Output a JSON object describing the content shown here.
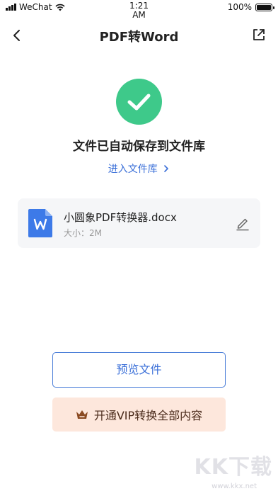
{
  "status_bar": {
    "carrier": "WeChat",
    "time": "1:21\nAM",
    "time_line1": "1:21",
    "time_line2": "AM",
    "battery": "100%",
    "battery_level": 1.0
  },
  "nav": {
    "title": "PDF转Word"
  },
  "success": {
    "message": "文件已自动保存到文件库",
    "library_link": "进入文件库",
    "color": "#3ec98a"
  },
  "file": {
    "name": "小圆象PDF转换器.docx",
    "size": "大小：2M",
    "icon": "word-doc-icon",
    "icon_color": "#3d7ae8"
  },
  "actions": {
    "preview_label": "预览文件",
    "vip_label": "开通VIP转换全部内容"
  },
  "watermark": {
    "text": "KK下载",
    "url": "www.kkx.net"
  }
}
